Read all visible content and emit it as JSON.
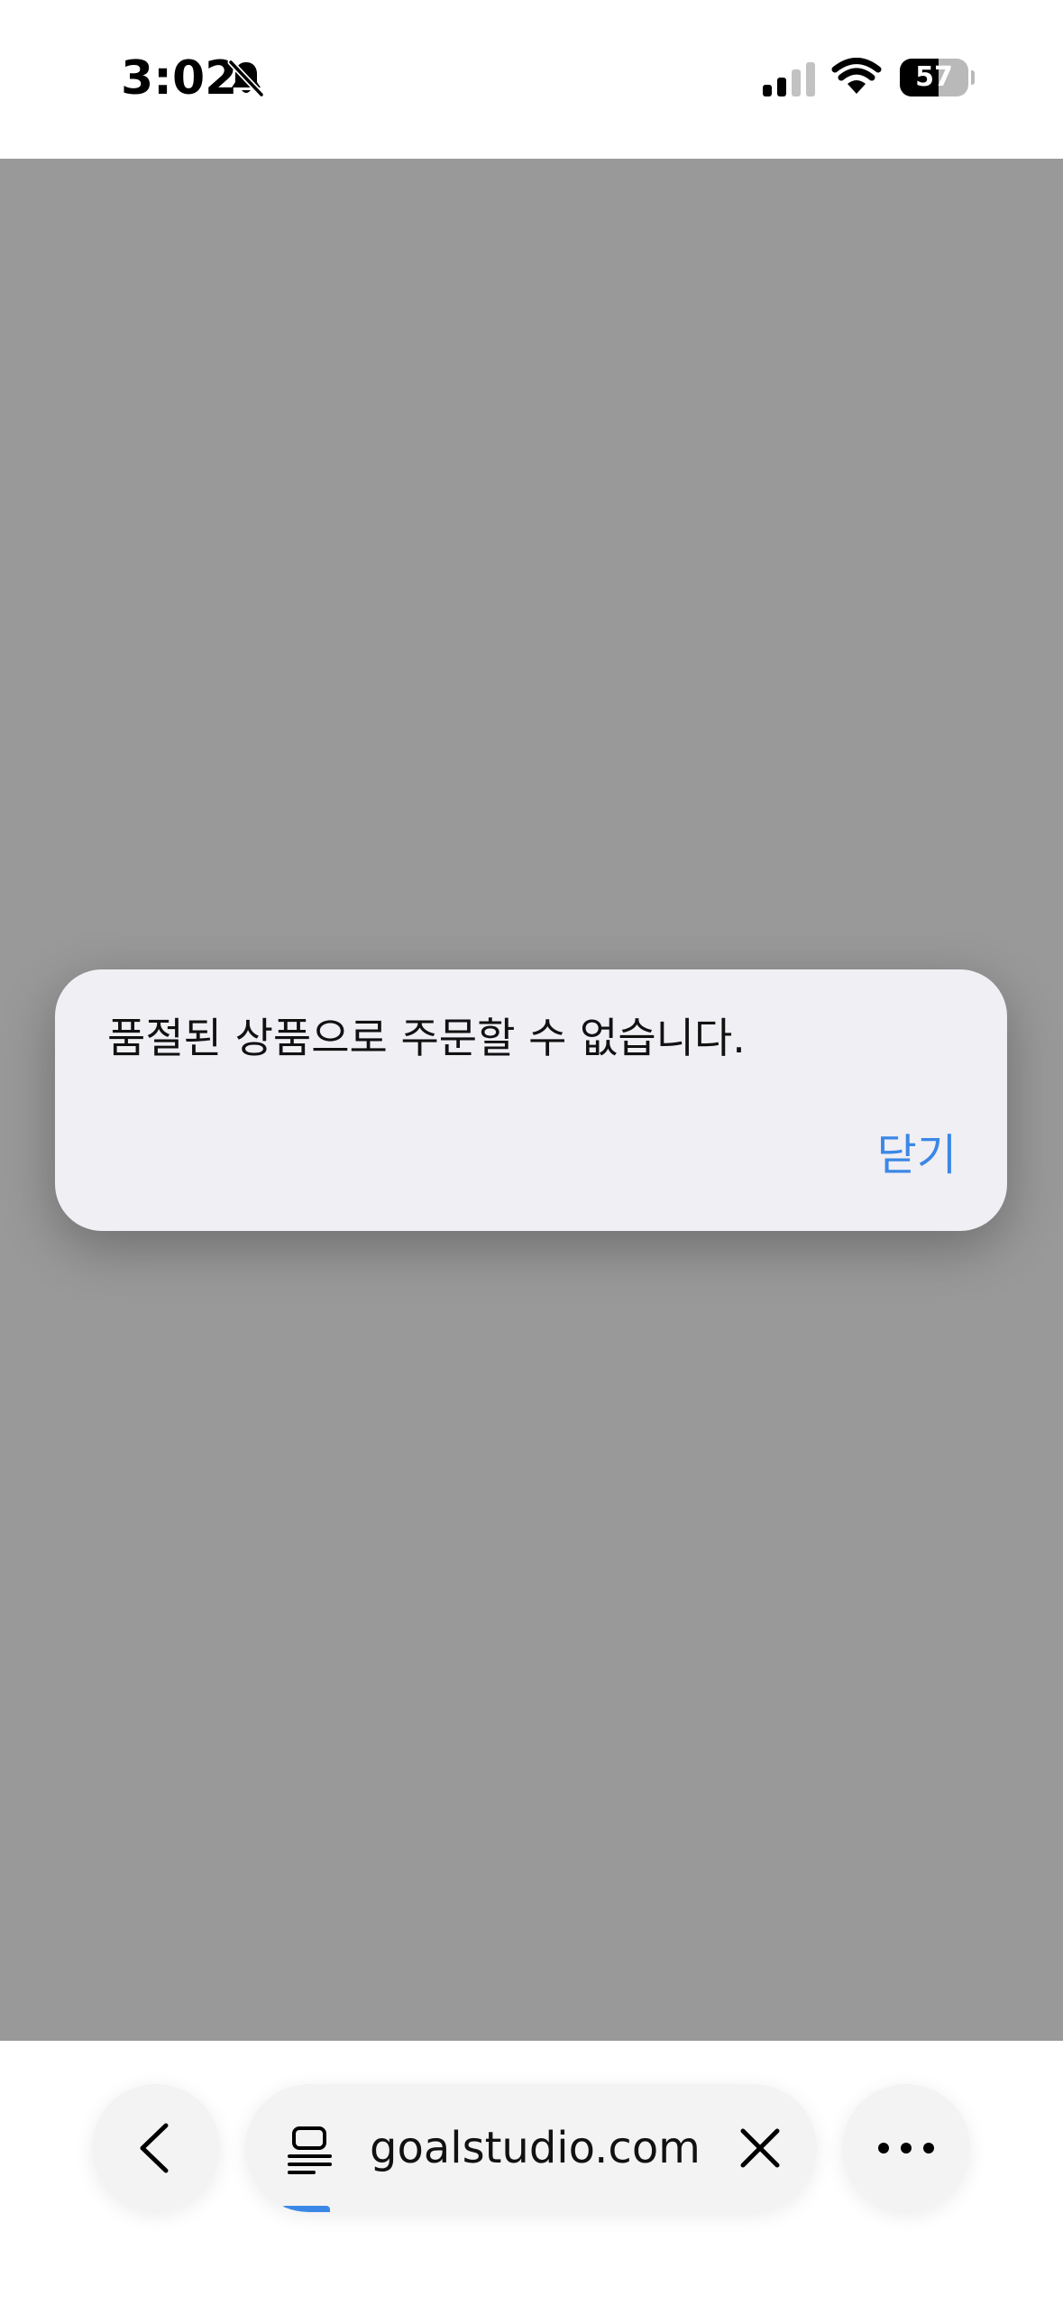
{
  "status_bar": {
    "time": "3:02",
    "battery_level": "57",
    "battery_fraction": 0.57,
    "silent_icon": "bell-slash-icon",
    "signal_icon": "cellular-signal-icon",
    "wifi_icon": "wifi-icon"
  },
  "alert": {
    "message": "품절된 상품으로 주문할 수 없습니다.",
    "close_label": "닫기"
  },
  "toolbar": {
    "back_icon": "chevron-left-icon",
    "tabs_icon": "tabs-icon",
    "url": "goalstudio.com",
    "clear_icon": "close-icon",
    "more_icon": "ellipsis-icon",
    "load_progress": 0.08
  },
  "colors": {
    "accent": "#3b87e6",
    "overlay": "#999999",
    "dialog_background": "#f0eff4"
  }
}
